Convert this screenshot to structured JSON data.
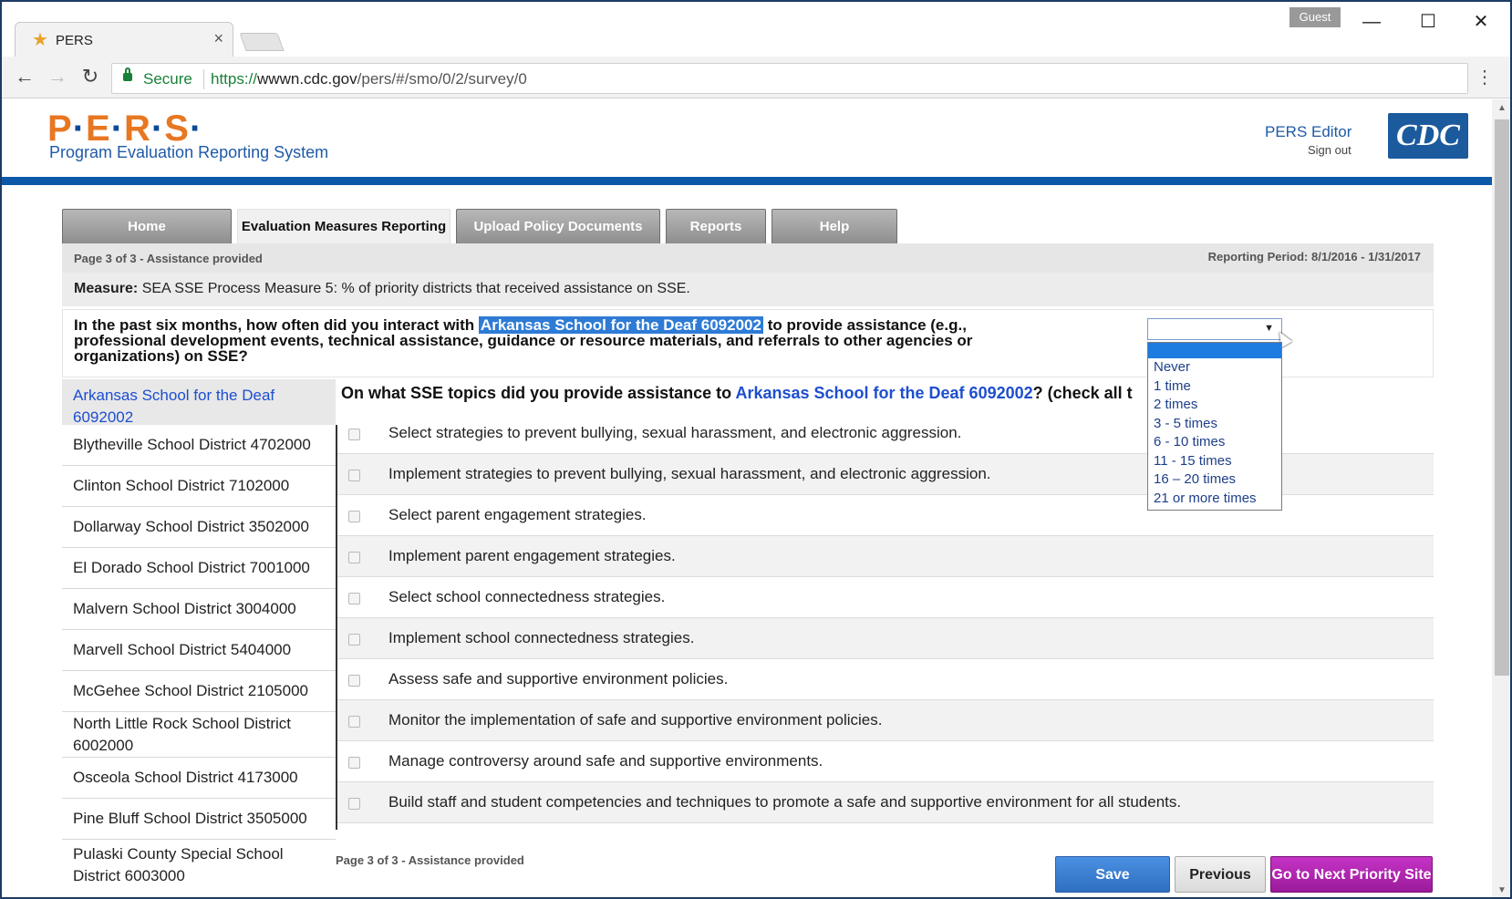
{
  "browser": {
    "tab_title": "PERS",
    "tab_close": "×",
    "guest_label": "Guest",
    "secure_label": "Secure",
    "url_scheme": "https://",
    "url_host": "wwwn.cdc.gov",
    "url_path": "/pers/#/smo/0/2/survey/0",
    "window_minimize": "—",
    "window_maximize": "☐",
    "window_close": "✕"
  },
  "header": {
    "logo_letters": [
      "P",
      "E",
      "R",
      "S"
    ],
    "logo_subtitle": "Program Evaluation Reporting System",
    "user_name": "PERS Editor",
    "sign_out": "Sign out",
    "cdc_logo": "CDC"
  },
  "nav": {
    "tabs": [
      {
        "label": "Home",
        "active": false
      },
      {
        "label": "Evaluation Measures Reporting",
        "active": true
      },
      {
        "label": "Upload Policy Documents",
        "active": false
      },
      {
        "label": "Reports",
        "active": false
      },
      {
        "label": "Help",
        "active": false
      }
    ]
  },
  "page": {
    "page_indicator": "Page 3 of 3 - Assistance provided",
    "reporting_period": "Reporting Period: 8/1/2016 - 1/31/2017",
    "measure_label": "Measure:",
    "measure_text": "SEA SSE Process Measure 5: % of priority districts that received assistance on SSE.",
    "question_prefix": "In the past six months, how often did you interact with",
    "question_highlight": "Arkansas School for the Deaf 6092002",
    "question_suffix": "to provide assistance (e.g., professional development events, technical assistance, guidance or resource materials, and referrals to other agencies or organizations) on SSE?",
    "frequency_select": {
      "selected": "",
      "options": [
        "",
        "Never",
        "1 time",
        "2 times",
        "3 - 5 times",
        "6 - 10 times",
        "11 - 15 times",
        "16 – 20 times",
        "21 or more times"
      ]
    },
    "selected_site": "Arkansas School for the Deaf 6092002",
    "sites": [
      "Blytheville School District 4702000",
      "Clinton School District 7102000",
      "Dollarway School District 3502000",
      "El Dorado School District 7001000",
      "Malvern School District 3004000",
      "Marvell School District 5404000",
      "McGehee School District 2105000",
      "North Little Rock School District 6002000",
      "Osceola School District 4173000",
      "Pine Bluff School District 3505000",
      "Pulaski County Special School District 6003000"
    ],
    "topics_heading_prefix": "On what",
    "topics_heading_sse": "SSE",
    "topics_heading_mid": "topics did you provide assistance to",
    "topics_heading_site": "Arkansas School for the Deaf 6092002",
    "topics_heading_suffix": "? (check all t",
    "topics": [
      "Select strategies to prevent bullying, sexual harassment, and electronic aggression.",
      "Implement strategies to prevent bullying, sexual harassment, and electronic aggression.",
      "Select parent engagement strategies.",
      "Implement parent engagement strategies.",
      "Select school connectedness strategies.",
      "Implement school connectedness strategies.",
      "Assess safe and supportive environment policies.",
      "Monitor the implementation of safe and supportive environment policies.",
      "Manage controversy around safe and supportive environments.",
      "Build staff and student competencies and techniques to promote a safe and supportive environment for all students."
    ],
    "footer_page_indicator": "Page 3 of 3 - Assistance provided",
    "buttons": {
      "save": "Save",
      "previous": "Previous",
      "next": "Go to Next Priority Site"
    }
  },
  "colors": {
    "brand_orange": "#e87722",
    "brand_blue": "#0b58a8",
    "link_blue": "#1d4ecf",
    "next_button": "#b026b0",
    "save_button": "#3a80d2"
  }
}
